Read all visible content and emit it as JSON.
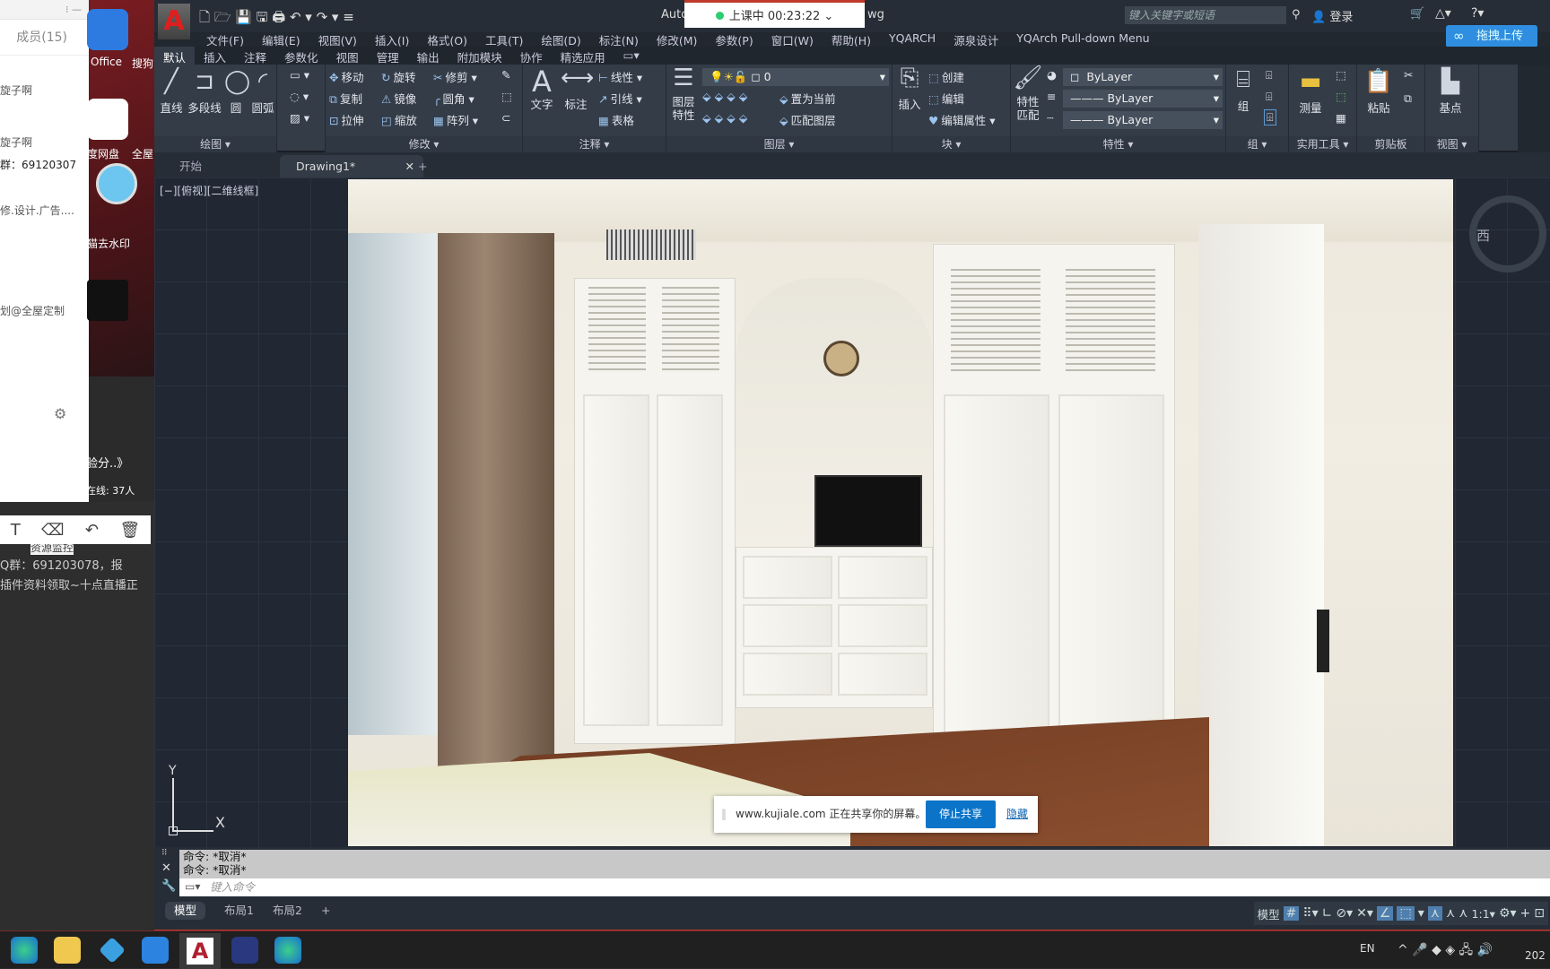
{
  "chat": {
    "members": "成员(15)",
    "lines": [
      "旋子啊",
      "旋子啊",
      "群：69120307",
      "修.设计.广告....",
      "划@全屋定制"
    ],
    "notice": "验分..》",
    "online": "在线: 37人",
    "msg1": "Q群：691203078，报",
    "msg2": "插件资料领取~十点直播正",
    "resource": "资源监控"
  },
  "desktop": {
    "icons": [
      {
        "label": "Office"
      },
      {
        "label": "搜狗"
      },
      {
        "label": "度网盘"
      },
      {
        "label": "全屋"
      },
      {
        "label": "猫去水印"
      }
    ]
  },
  "app": {
    "title_fragment": "Auto",
    "title_suffix": "wg",
    "search_placeholder": "键入关键字或短语",
    "login": "登录",
    "upload": "拖拽上传"
  },
  "timer": {
    "text": "上课中 00:23:22"
  },
  "menu": [
    "文件(F)",
    "编辑(E)",
    "视图(V)",
    "插入(I)",
    "格式(O)",
    "工具(T)",
    "绘图(D)",
    "标注(N)",
    "修改(M)",
    "参数(P)",
    "窗口(W)",
    "帮助(H)",
    "YQARCH",
    "源泉设计",
    "YQArch Pull-down Menu"
  ],
  "ribbon_tabs": [
    "默认",
    "插入",
    "注释",
    "参数化",
    "视图",
    "管理",
    "输出",
    "附加模块",
    "协作",
    "精选应用"
  ],
  "ribbon": {
    "draw": {
      "title": "绘图",
      "tools": [
        "直线",
        "多段线",
        "圆",
        "圆弧"
      ]
    },
    "modify": {
      "title": "修改",
      "tools": [
        "移动",
        "旋转",
        "修剪",
        "复制",
        "镜像",
        "圆角",
        "拉伸",
        "缩放",
        "阵列"
      ]
    },
    "annotate": {
      "title": "注释",
      "tools": [
        "文字",
        "标注",
        "线性",
        "引线",
        "表格"
      ]
    },
    "layer": {
      "title": "图层",
      "big": "图层特性",
      "current": "0",
      "tools": [
        "置为当前",
        "匹配图层"
      ]
    },
    "block": {
      "title": "块",
      "big": "插入",
      "tools": [
        "创建",
        "编辑",
        "编辑属性"
      ]
    },
    "props": {
      "title": "特性",
      "big": "特性匹配",
      "color": "ByLayer",
      "linetype": "ByLayer",
      "lineweight": "ByLayer"
    },
    "group": {
      "title": "组",
      "big": "组"
    },
    "utils": {
      "title": "实用工具",
      "big": "测量"
    },
    "clipboard": {
      "title": "剪贴板",
      "big": "粘贴"
    },
    "view": {
      "title": "视图",
      "big": "基点"
    }
  },
  "file_tabs": [
    "开始",
    "Drawing1*"
  ],
  "viewport_label": "[−][俯视][二维线框]",
  "compass": "西",
  "ucs": {
    "x": "X",
    "y": "Y"
  },
  "share": {
    "text": "www.kujiale.com 正在共享你的屏幕。",
    "stop": "停止共享",
    "hide": "隐藏"
  },
  "command": {
    "history": [
      "命令: *取消*",
      "命令: *取消*"
    ],
    "placeholder": "键入命令"
  },
  "layout_tabs": [
    "模型",
    "布局1",
    "布局2"
  ],
  "statusbar": {
    "model": "模型",
    "scale": "1:1"
  },
  "tray": {
    "lang": "EN",
    "clock_fragment": "202"
  }
}
